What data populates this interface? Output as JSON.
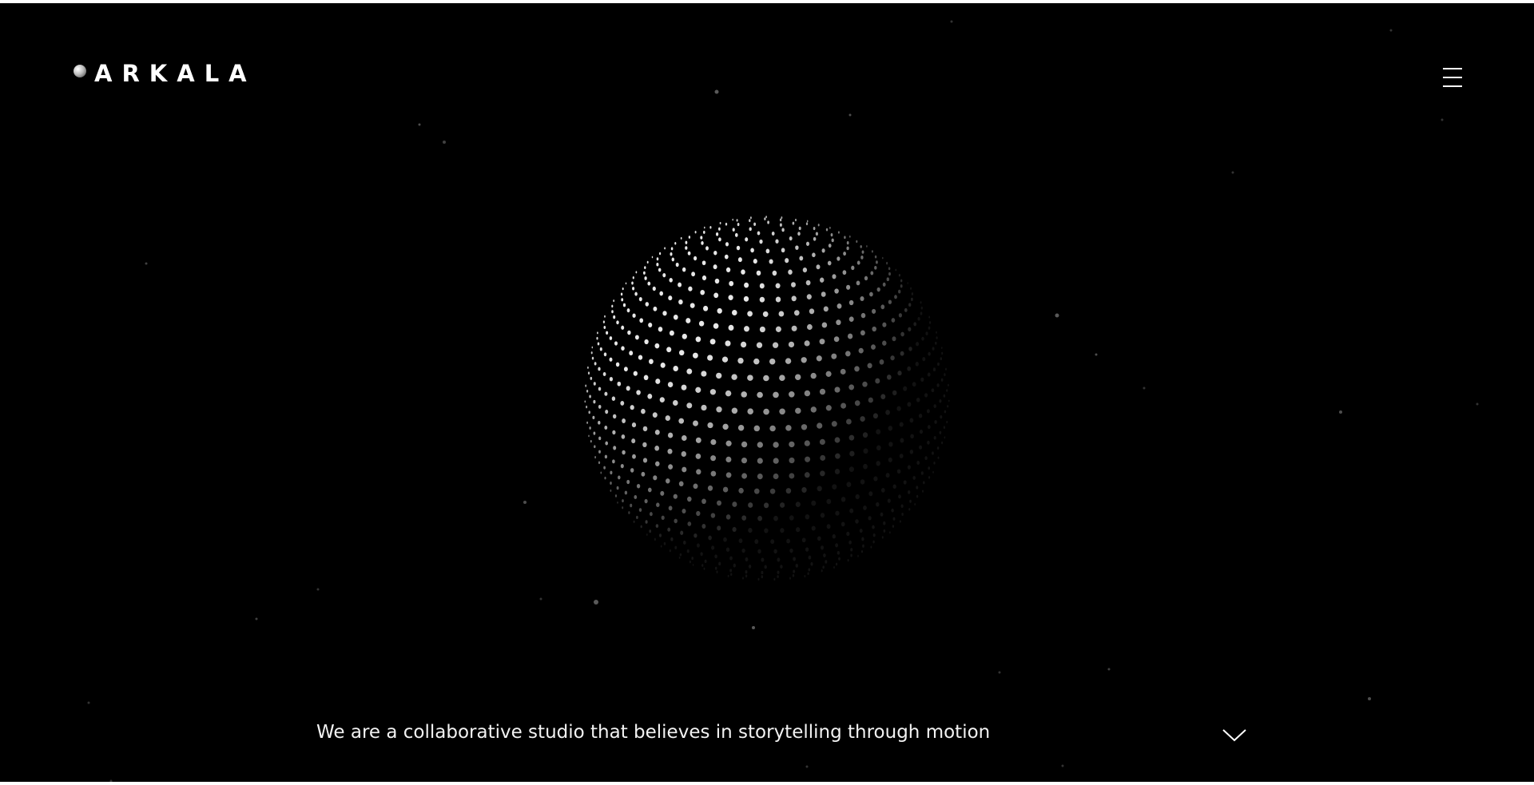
{
  "brand": {
    "name": "ARKALA",
    "colors": {
      "background": "#000000",
      "foreground": "#ffffff"
    }
  },
  "header": {
    "logo_icon": "moon-orb-icon",
    "menu_icon": "hamburger-menu-icon"
  },
  "hero": {
    "visual": "dotted-globe",
    "tagline": "We are a collaborative studio that believes in storytelling through motion",
    "scroll_icon": "chevron-down-icon"
  }
}
